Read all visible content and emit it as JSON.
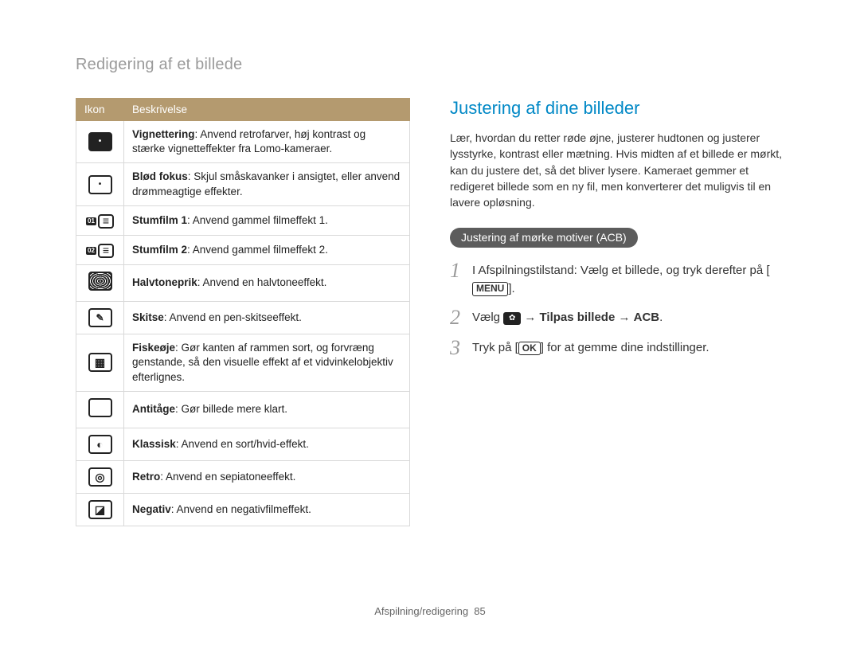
{
  "page_title": "Redigering af et billede",
  "table": {
    "headers": {
      "icon": "Ikon",
      "desc": "Beskrivelse"
    },
    "rows": [
      {
        "icon_name": "vignette-icon",
        "term": "Vignettering",
        "rest": ": Anvend retrofarver, høj kontrast og stærke vignetteffekter fra Lomo-kameraer."
      },
      {
        "icon_name": "soft-focus-icon",
        "term": "Blød fokus",
        "rest": ": Skjul småskavanker i ansigtet, eller anvend drømmeagtige effekter."
      },
      {
        "icon_name": "oldfilm1-icon",
        "term": "Stumfilm 1",
        "rest": ": Anvend gammel filmeffekt 1."
      },
      {
        "icon_name": "oldfilm2-icon",
        "term": "Stumfilm 2",
        "rest": ": Anvend gammel filmeffekt 2."
      },
      {
        "icon_name": "halftone-icon",
        "term": "Halvtoneprik",
        "rest": ": Anvend en halvtoneeffekt."
      },
      {
        "icon_name": "sketch-icon",
        "term": "Skitse",
        "rest": ": Anvend en pen-skitseeffekt."
      },
      {
        "icon_name": "fisheye-icon",
        "term": "Fiskeøje",
        "rest": ": Gør kanten af rammen sort, og forvræng genstande, så den visuelle effekt af et vidvinkelobjektiv efterlignes."
      },
      {
        "icon_name": "antifog-icon",
        "term": "Antitåge",
        "rest": ": Gør billede mere klart."
      },
      {
        "icon_name": "classic-icon",
        "term": "Klassisk",
        "rest": ": Anvend en sort/hvid-effekt."
      },
      {
        "icon_name": "retro-icon",
        "term": "Retro",
        "rest": ": Anvend en sepiatoneeffekt."
      },
      {
        "icon_name": "negative-icon",
        "term": "Negativ",
        "rest": ": Anvend en negativfilmeffekt."
      }
    ]
  },
  "right": {
    "heading": "Justering af dine billeder",
    "intro": "Lær, hvordan du retter røde øjne, justerer hudtonen og justerer lysstyrke, kontrast eller mætning. Hvis midten af et billede er mørkt, kan du justere det, så det bliver lysere. Kameraet gemmer et redigeret billede som en ny fil, men konverterer det muligvis til en lavere opløsning.",
    "pill": "Justering af mørke motiver (ACB)",
    "steps": {
      "s1_pre": "I Afspilningstilstand: Vælg et billede, og tryk derefter på [",
      "s1_menu": "MENU",
      "s1_post": "].",
      "s2_pre": "Vælg ",
      "s2_arrow1": " → ",
      "s2_b1": "Tilpas billede",
      "s2_arrow2": " → ",
      "s2_b2": "ACB",
      "s2_post": ".",
      "s3_pre": "Tryk på [",
      "s3_ok": "OK",
      "s3_post": "] for at gemme dine indstillinger."
    }
  },
  "footer": {
    "section": "Afspilning/redigering",
    "page": "85"
  }
}
